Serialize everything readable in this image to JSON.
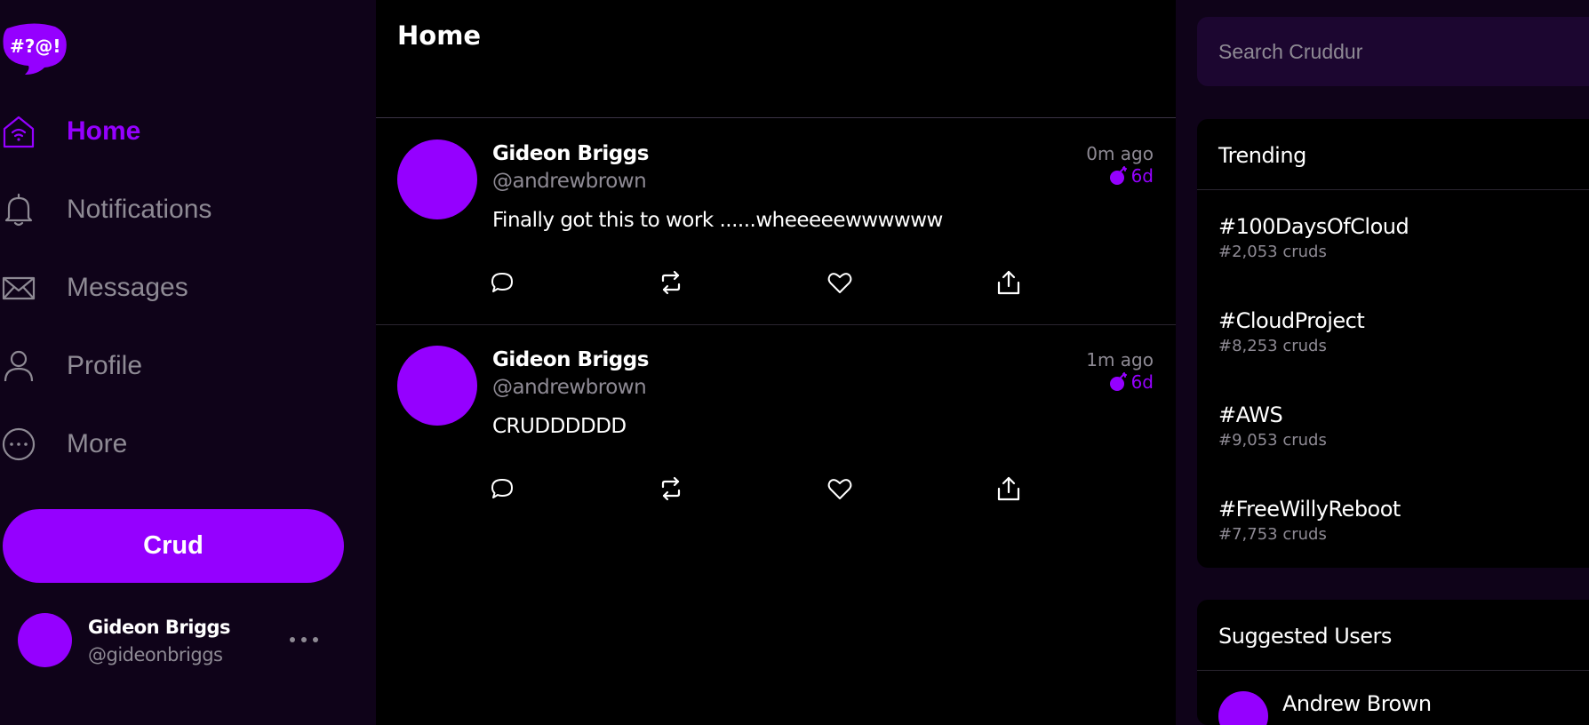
{
  "app": {
    "logo_text": "#?@!"
  },
  "sidebar": {
    "items": [
      {
        "label": "Home",
        "icon": "home-icon",
        "active": true
      },
      {
        "label": "Notifications",
        "icon": "bell-icon",
        "active": false
      },
      {
        "label": "Messages",
        "icon": "mail-icon",
        "active": false
      },
      {
        "label": "Profile",
        "icon": "user-icon",
        "active": false
      },
      {
        "label": "More",
        "icon": "more-circle-icon",
        "active": false
      }
    ],
    "crud_button": "Crud",
    "profile": {
      "name": "Gideon Briggs",
      "handle": "@gideonbriggs"
    }
  },
  "feed": {
    "title": "Home",
    "posts": [
      {
        "name": "Gideon Briggs",
        "handle": "@andrewbrown",
        "time": "0m ago",
        "expires": "6d",
        "text": "Finally got this to work ......wheeeeewwwwww"
      },
      {
        "name": "Gideon Briggs",
        "handle": "@andrewbrown",
        "time": "1m ago",
        "expires": "6d",
        "text": "CRUDDDDDD"
      }
    ]
  },
  "right": {
    "search": {
      "placeholder": "Search Cruddur"
    },
    "trending": {
      "title": "Trending",
      "items": [
        {
          "tag": "#100DaysOfCloud",
          "count": "#2,053 cruds"
        },
        {
          "tag": "#CloudProject",
          "count": "#8,253 cruds"
        },
        {
          "tag": "#AWS",
          "count": "#9,053 cruds"
        },
        {
          "tag": "#FreeWillyReboot",
          "count": "#7,753 cruds"
        }
      ]
    },
    "suggested": {
      "title": "Suggested Users",
      "users": [
        {
          "name": "Andrew Brown"
        }
      ]
    }
  },
  "colors": {
    "accent": "#9500ff",
    "sidebar_bg": "#0f0319",
    "muted": "#8e8a94"
  }
}
